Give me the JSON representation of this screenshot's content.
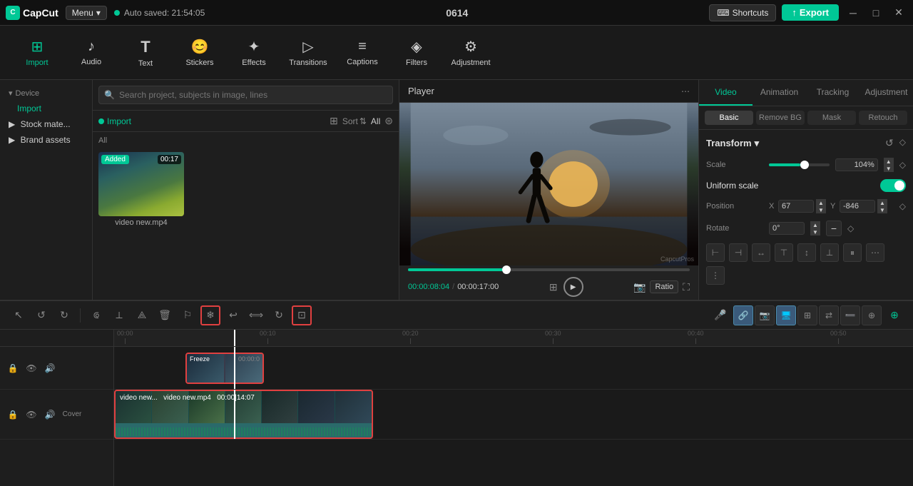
{
  "app": {
    "name": "CapCut",
    "auto_saved": "Auto saved: 21:54:05",
    "project_id": "0614"
  },
  "top_bar": {
    "logo": "CapCut",
    "menu_label": "Menu",
    "shortcuts_label": "Shortcuts",
    "export_label": "Export"
  },
  "toolbar": {
    "items": [
      {
        "id": "import",
        "label": "Import",
        "icon": "⊞"
      },
      {
        "id": "audio",
        "label": "Audio",
        "icon": "♪"
      },
      {
        "id": "text",
        "label": "Text",
        "icon": "T"
      },
      {
        "id": "stickers",
        "label": "Stickers",
        "icon": "★"
      },
      {
        "id": "effects",
        "label": "Effects",
        "icon": "✦"
      },
      {
        "id": "transitions",
        "label": "Transitions",
        "icon": "▷"
      },
      {
        "id": "captions",
        "label": "Captions",
        "icon": "≡"
      },
      {
        "id": "filters",
        "label": "Filters",
        "icon": "◈"
      },
      {
        "id": "adjustment",
        "label": "Adjustment",
        "icon": "⚙"
      }
    ]
  },
  "left_panel": {
    "sections": [
      {
        "id": "device",
        "label": "Device",
        "type": "header"
      },
      {
        "id": "import",
        "label": "Import",
        "type": "link"
      },
      {
        "id": "stock",
        "label": "Stock mate...",
        "type": "item"
      },
      {
        "id": "brand",
        "label": "Brand assets",
        "type": "item"
      }
    ]
  },
  "media_panel": {
    "search_placeholder": "Search project, subjects in image, lines",
    "import_label": "Import",
    "sort_label": "Sort",
    "all_label": "All",
    "grid_label": "All",
    "items": [
      {
        "name": "video new.mp4",
        "duration": "00:17",
        "added": "Added"
      }
    ]
  },
  "player": {
    "title": "Player",
    "current_time": "00:00:08:04",
    "total_time": "00:00:17:00",
    "ratio_label": "Ratio",
    "watermark": "CapcutPros"
  },
  "right_panel": {
    "tabs": [
      {
        "id": "video",
        "label": "Video",
        "active": true
      },
      {
        "id": "animation",
        "label": "Animation",
        "active": false
      },
      {
        "id": "tracking",
        "label": "Tracking",
        "active": false
      },
      {
        "id": "adjustment",
        "label": "Adjustment",
        "active": false
      }
    ],
    "sub_tabs": [
      {
        "id": "basic",
        "label": "Basic",
        "active": true
      },
      {
        "id": "remove_bg",
        "label": "Remove BG",
        "active": false
      },
      {
        "id": "mask",
        "label": "Mask",
        "active": false
      },
      {
        "id": "retouch",
        "label": "Retouch",
        "active": false
      }
    ],
    "transform": {
      "title": "Transform",
      "scale_label": "Scale",
      "scale_value": "104%",
      "scale_percent": 52,
      "uniform_scale_label": "Uniform scale",
      "uniform_scale_enabled": true,
      "position_label": "Position",
      "pos_x_label": "X",
      "pos_x_value": "67",
      "pos_y_label": "Y",
      "pos_y_value": "-846",
      "rotate_label": "Rotate",
      "rotate_value": "0°"
    },
    "align_icons": [
      "⊢",
      "⊣",
      "↔",
      "⊤",
      "⊥",
      "↕",
      "⋮",
      "⋯",
      "⋱"
    ]
  },
  "timeline": {
    "toolbar_btns": [
      {
        "id": "select",
        "icon": "↖",
        "label": "select"
      },
      {
        "id": "undo",
        "icon": "↺",
        "label": "undo"
      },
      {
        "id": "redo",
        "icon": "↻",
        "label": "redo"
      },
      {
        "id": "split1",
        "icon": "⟃",
        "label": "split"
      },
      {
        "id": "split2",
        "icon": "⟂",
        "label": "split2"
      },
      {
        "id": "split3",
        "icon": "⟁",
        "label": "split3"
      },
      {
        "id": "delete",
        "icon": "🗑",
        "label": "delete"
      },
      {
        "id": "bookmark",
        "icon": "⚐",
        "label": "bookmark"
      },
      {
        "id": "freeze",
        "icon": "❄",
        "label": "freeze"
      },
      {
        "id": "redo2",
        "icon": "↩",
        "label": "redo2"
      },
      {
        "id": "flip",
        "icon": "⟺",
        "label": "flip"
      },
      {
        "id": "rotate_tl",
        "icon": "↻",
        "label": "rotate"
      },
      {
        "id": "crop",
        "icon": "⊡",
        "label": "crop"
      }
    ],
    "right_btns": [
      {
        "id": "mic",
        "icon": "🎤",
        "label": "mic"
      },
      {
        "id": "link",
        "icon": "🔗",
        "label": "link",
        "active": true
      },
      {
        "id": "camera",
        "icon": "📷",
        "label": "camera",
        "active": false
      },
      {
        "id": "screen",
        "icon": "🖥",
        "label": "screen",
        "active": true
      },
      {
        "id": "pip",
        "icon": "⊞",
        "label": "pip"
      },
      {
        "id": "replace",
        "icon": "⊕",
        "label": "replace"
      },
      {
        "id": "remove",
        "icon": "➖",
        "label": "remove"
      },
      {
        "id": "add",
        "icon": "⊕",
        "label": "add"
      },
      {
        "id": "zoom",
        "icon": "⊕",
        "label": "zoom"
      }
    ],
    "ruler": {
      "marks": [
        "00:00",
        "00:10",
        "00:20",
        "00:30",
        "00:40",
        "00:50"
      ]
    },
    "tracks": [
      {
        "id": "freeze-track",
        "type": "freeze",
        "clip_label": "Freeze",
        "clip_time": "00:00:0"
      },
      {
        "id": "main-track",
        "type": "video",
        "clip_label": "video new...",
        "clip_name": "video new.mp4",
        "clip_duration": "00:00|14:07",
        "cover_label": "Cover"
      }
    ]
  }
}
